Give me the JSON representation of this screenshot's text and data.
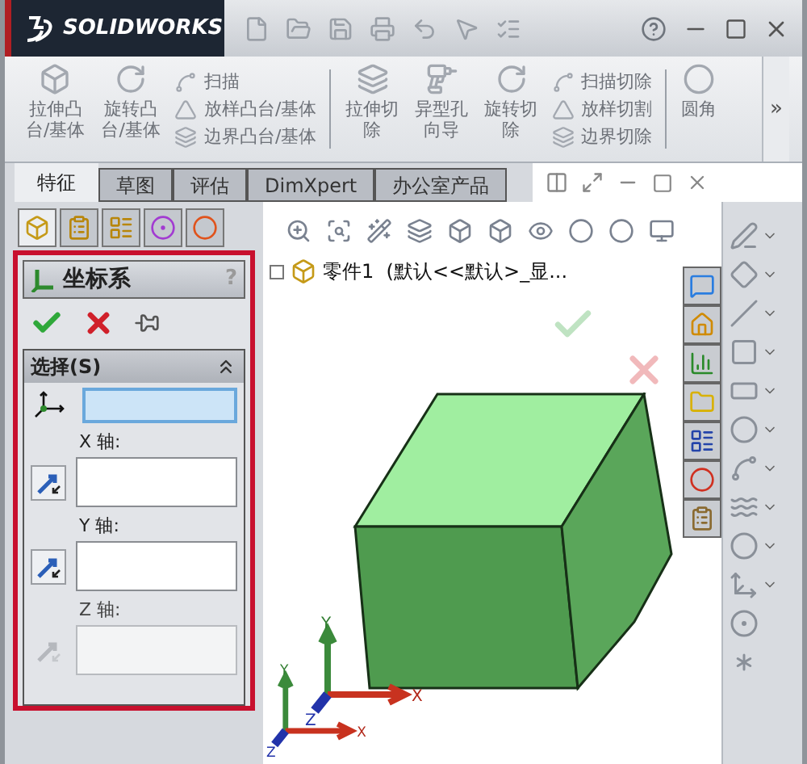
{
  "title_bar": {
    "logo": "SOLIDWORKS"
  },
  "ribbon": [
    {
      "kind": "large",
      "lines": [
        "拉伸凸",
        "台/基体"
      ]
    },
    {
      "kind": "large",
      "lines": [
        "旋转凸",
        "台/基体"
      ]
    },
    {
      "kind": "stack",
      "items": [
        "扫描",
        "放样凸台/基体",
        "边界凸台/基体"
      ]
    },
    {
      "kind": "separator"
    },
    {
      "kind": "large",
      "lines": [
        "拉伸切",
        "除"
      ]
    },
    {
      "kind": "large",
      "lines": [
        "异型孔",
        "向导"
      ]
    },
    {
      "kind": "large",
      "lines": [
        "旋转切",
        "除"
      ]
    },
    {
      "kind": "stack",
      "items": [
        "扫描切除",
        "放样切割",
        "边界切除"
      ]
    },
    {
      "kind": "separator"
    },
    {
      "kind": "large",
      "lines": [
        "圆角"
      ]
    }
  ],
  "ribbon_more": "»",
  "tabs": [
    {
      "label": "特征",
      "selected": true
    },
    {
      "label": "草图",
      "selected": false
    },
    {
      "label": "评估",
      "selected": false
    },
    {
      "label": "DimXpert",
      "selected": false
    },
    {
      "label": "办公室产品",
      "selected": false
    }
  ],
  "manager_tabs": [
    {
      "selected": true
    },
    {
      "selected": false
    },
    {
      "selected": false
    },
    {
      "selected": false
    },
    {
      "selected": false
    }
  ],
  "property_manager": {
    "title": "坐标系",
    "help": "?",
    "group": {
      "title": "选择(S)",
      "expanded": true,
      "fields": [
        {
          "kind": "origin",
          "selected": true,
          "disabled": false
        },
        {
          "kind": "axis",
          "label": "X 轴:",
          "selected": false,
          "disabled": false
        },
        {
          "kind": "axis",
          "label": "Y 轴:",
          "selected": false,
          "disabled": false
        },
        {
          "kind": "axis",
          "label": "Z 轴:",
          "selected": false,
          "disabled": true
        }
      ]
    }
  },
  "feature_tree": {
    "label": "零件1  (默认<<默认>_显...",
    "expanded": false
  },
  "triads": [
    {
      "labels": [
        "X",
        "Y",
        "Z"
      ]
    },
    {
      "labels": [
        "X",
        "Y",
        "Z"
      ]
    }
  ]
}
